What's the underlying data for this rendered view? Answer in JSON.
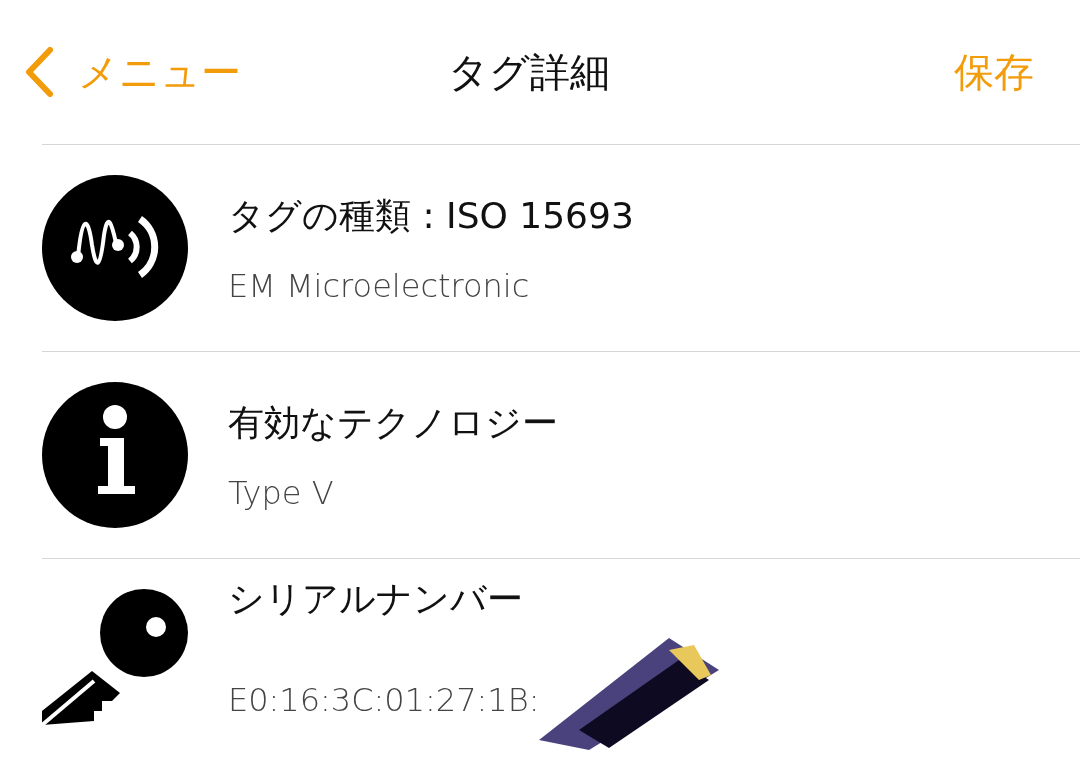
{
  "nav": {
    "back": "メニュー",
    "title": "タグ詳細",
    "action": "保存"
  },
  "rows": [
    {
      "kind": "tag",
      "title": "タグの種類 : ISO 15693",
      "subtitle": "EM Microelectronic",
      "redacted": false
    },
    {
      "kind": "info",
      "title": "有効なテクノロジー",
      "subtitle": "Type V",
      "redacted": false
    },
    {
      "kind": "key",
      "title": "シリアルナンバー",
      "subtitle": "E0:16:3C:01:27:1B:",
      "redacted": true
    }
  ]
}
